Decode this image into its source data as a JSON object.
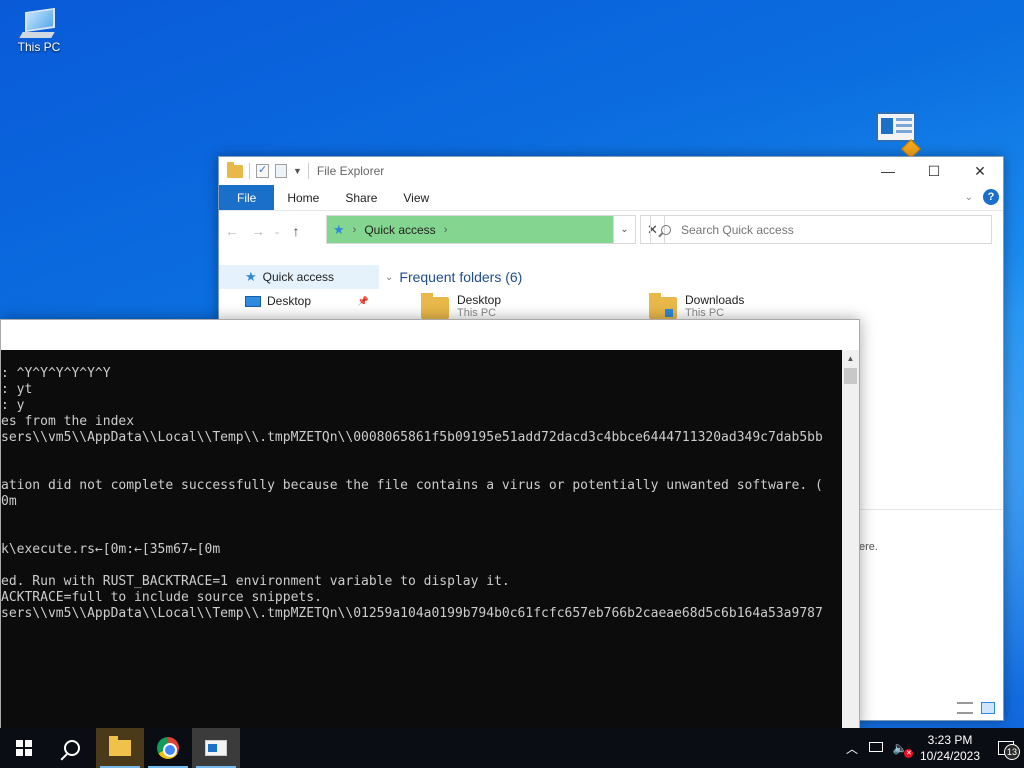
{
  "desktop": {
    "icons": [
      {
        "label": "This PC"
      }
    ]
  },
  "explorer": {
    "title": "File Explorer",
    "ribbon_tabs": [
      "File",
      "Home",
      "Share",
      "View"
    ],
    "address": {
      "location": "Quick access"
    },
    "search": {
      "placeholder": "Search Quick access"
    },
    "nav_pane": [
      {
        "label": "Quick access",
        "icon": "star-icon",
        "selected": true
      },
      {
        "label": "Desktop",
        "icon": "desktop-icon",
        "pinned": true
      }
    ],
    "frequent_folders": {
      "header": "Frequent folders (6)",
      "items": [
        {
          "name": "Desktop",
          "location": "This PC"
        },
        {
          "name": "Downloads",
          "location": "This PC"
        }
      ]
    },
    "partial_right_text": "ere."
  },
  "terminal": {
    "lines": [
      ": ^Y^Y^Y^Y^Y^Y",
      ": yt",
      ": y",
      "es from the index",
      "sers\\\\vm5\\\\AppData\\\\Local\\\\Temp\\\\.tmpMZETQn\\\\0008065861f5b09195e51add72dacd3c4bbce6444711320ad349c7dab5bb",
      "",
      "",
      "ation did not complete successfully because the file contains a virus or potentially unwanted software. (",
      "0m",
      "",
      "",
      "k\\execute.rs←[0m:←[35m67←[0m",
      "",
      "ed. Run with RUST_BACKTRACE=1 environment variable to display it.",
      "ACKTRACE=full to include source snippets.",
      "sers\\\\vm5\\\\AppData\\\\Local\\\\Temp\\\\.tmpMZETQn\\\\01259a104a0199b794b0c61fcfc657eb766b2caeae68d5c6b164a53a9787"
    ]
  },
  "taskbar": {
    "clock_time": "3:23 PM",
    "clock_date": "10/24/2023",
    "notification_count": "13"
  }
}
